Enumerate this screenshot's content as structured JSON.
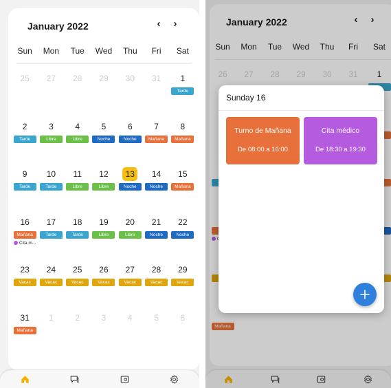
{
  "colors": {
    "tarde": "#3aa6cf",
    "libre": "#6cc04a",
    "noche": "#1f6ac2",
    "manana": "#e8703a",
    "vacac": "#dfa60d",
    "today": "#f5be12",
    "cita": "#b55be0",
    "fab": "#2f7fdd"
  },
  "left_screen": {
    "month_title": "January 2022",
    "prev_icon": "‹",
    "next_icon": "›",
    "weekdays": [
      "Sun",
      "Mon",
      "Tue",
      "Wed",
      "Thu",
      "Fri",
      "Sat"
    ],
    "cells": [
      {
        "day": "25",
        "muted": true
      },
      {
        "day": "27",
        "muted": true
      },
      {
        "day": "28",
        "muted": true
      },
      {
        "day": "29",
        "muted": true
      },
      {
        "day": "30",
        "muted": true
      },
      {
        "day": "31",
        "muted": true
      },
      {
        "day": "1",
        "tag": "Tarde",
        "color": "tarde"
      },
      {
        "day": "2",
        "tag": "Tarde",
        "color": "tarde"
      },
      {
        "day": "3",
        "tag": "Libre",
        "color": "libre"
      },
      {
        "day": "4",
        "tag": "Libre",
        "color": "libre"
      },
      {
        "day": "5",
        "tag": "Noche",
        "color": "noche"
      },
      {
        "day": "6",
        "tag": "Noche",
        "color": "noche"
      },
      {
        "day": "7",
        "tag": "Mañana",
        "color": "manana"
      },
      {
        "day": "8",
        "tag": "Mañana",
        "color": "manana"
      },
      {
        "day": "9",
        "tag": "Tarde",
        "color": "tarde"
      },
      {
        "day": "10",
        "tag": "Tarde",
        "color": "tarde"
      },
      {
        "day": "11",
        "tag": "Libre",
        "color": "libre"
      },
      {
        "day": "12",
        "tag": "Libre",
        "color": "libre"
      },
      {
        "day": "13",
        "tag": "Noche",
        "color": "noche",
        "today": true
      },
      {
        "day": "14",
        "tag": "Noche",
        "color": "noche"
      },
      {
        "day": "15",
        "tag": "Mañana",
        "color": "manana"
      },
      {
        "day": "16",
        "tag": "Mañana",
        "color": "manana",
        "event": "Cita m..."
      },
      {
        "day": "17",
        "tag": "Tarde",
        "color": "tarde"
      },
      {
        "day": "18",
        "tag": "Tarde",
        "color": "tarde"
      },
      {
        "day": "19",
        "tag": "Libre",
        "color": "libre"
      },
      {
        "day": "20",
        "tag": "Libre",
        "color": "libre"
      },
      {
        "day": "21",
        "tag": "Noche",
        "color": "noche"
      },
      {
        "day": "22",
        "tag": "Noche",
        "color": "noche"
      },
      {
        "day": "23",
        "tag": "Vacac",
        "color": "vacac"
      },
      {
        "day": "24",
        "tag": "Vacac",
        "color": "vacac"
      },
      {
        "day": "25",
        "tag": "Vacac",
        "color": "vacac"
      },
      {
        "day": "26",
        "tag": "Vacac",
        "color": "vacac"
      },
      {
        "day": "27",
        "tag": "Vacac",
        "color": "vacac"
      },
      {
        "day": "28",
        "tag": "Vacac",
        "color": "vacac"
      },
      {
        "day": "29",
        "tag": "Vacac",
        "color": "vacac"
      },
      {
        "day": "31",
        "tag": "Mañana",
        "color": "manana"
      },
      {
        "day": "1",
        "muted": true
      },
      {
        "day": "2",
        "muted": true
      },
      {
        "day": "3",
        "muted": true
      },
      {
        "day": "4",
        "muted": true
      },
      {
        "day": "5",
        "muted": true
      },
      {
        "day": "6",
        "muted": true
      }
    ]
  },
  "right_screen": {
    "month_title": "January 2022",
    "prev_icon": "‹",
    "next_icon": "›",
    "weekdays": [
      "Sun",
      "Mon",
      "Tue",
      "Wed",
      "Thu",
      "Fri",
      "Sat"
    ],
    "cells": [
      {
        "day": "26",
        "muted": true
      },
      {
        "day": "27",
        "muted": true
      },
      {
        "day": "28",
        "muted": true
      },
      {
        "day": "29",
        "muted": true
      },
      {
        "day": "30",
        "muted": true
      },
      {
        "day": "31",
        "muted": true
      },
      {
        "day": "1",
        "color": "tarde"
      },
      {},
      {},
      {},
      {},
      {},
      {},
      {
        "color": "manana"
      },
      {
        "color": "tarde"
      },
      {},
      {},
      {},
      {},
      {},
      {
        "color": "manana"
      },
      {
        "color": "manana",
        "event": "Cita m..."
      },
      {},
      {},
      {},
      {},
      {},
      {
        "color": "noche"
      },
      {
        "color": "vacac"
      },
      {},
      {},
      {},
      {},
      {},
      {
        "color": "vacac"
      },
      {
        "tag": "Mañana",
        "color": "manana"
      }
    ],
    "modal": {
      "title": "Sunday 16",
      "cards": [
        {
          "title": "Turno de Mañana",
          "subtitle": "De 08:00 a 16:00",
          "color": "manana"
        },
        {
          "title": "Cita médico",
          "subtitle": "De 18:30 a 19:30",
          "color": "cita"
        }
      ],
      "fab_label": "+"
    }
  },
  "bottom_nav": {
    "items": [
      {
        "icon": "home-icon",
        "active": true
      },
      {
        "icon": "chat-icon",
        "active": false
      },
      {
        "icon": "wallet-icon",
        "active": false
      },
      {
        "icon": "settings-icon",
        "active": false
      }
    ]
  }
}
